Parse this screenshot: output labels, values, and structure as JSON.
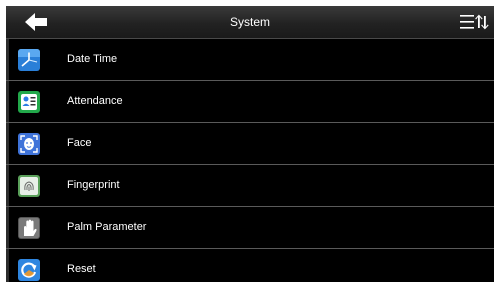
{
  "header": {
    "title": "System",
    "back_icon": "back-arrow-icon",
    "sort_icon": "sort-menu-icon"
  },
  "menu": {
    "items": [
      {
        "label": "Date Time",
        "icon": "clock-icon",
        "icon_color": "#2a7fd8"
      },
      {
        "label": "Attendance",
        "icon": "attendance-icon",
        "icon_color": "#22a84a"
      },
      {
        "label": "Face",
        "icon": "face-icon",
        "icon_color": "#3f73d9"
      },
      {
        "label": "Fingerprint",
        "icon": "fingerprint-icon",
        "icon_color": "#5aa05a"
      },
      {
        "label": "Palm Parameter",
        "icon": "palm-icon",
        "icon_color": "#777777"
      },
      {
        "label": "Reset",
        "icon": "reset-icon",
        "icon_color": "#2f86e0"
      }
    ]
  },
  "colors": {
    "background": "#000000",
    "header": "#262626",
    "divider": "#5a5a5a",
    "text": "#ffffff"
  }
}
